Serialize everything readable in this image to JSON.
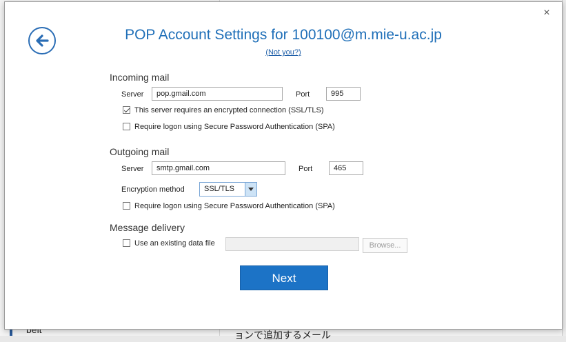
{
  "background": {
    "left_text": "beit",
    "right_text": "ョンで追加するメール"
  },
  "dialog": {
    "title": "POP Account Settings for 100100@m.mie-u.ac.jp",
    "not_you": "(Not you?)",
    "close_label": "×",
    "incoming": {
      "heading": "Incoming mail",
      "server_label": "Server",
      "server_value": "pop.gmail.com",
      "port_label": "Port",
      "port_value": "995",
      "ssl_label": "This server requires an encrypted connection (SSL/TLS)",
      "ssl_checked": true,
      "spa_label": "Require logon using Secure Password Authentication (SPA)",
      "spa_checked": false
    },
    "outgoing": {
      "heading": "Outgoing mail",
      "server_label": "Server",
      "server_value": "smtp.gmail.com",
      "port_label": "Port",
      "port_value": "465",
      "encryption_label": "Encryption method",
      "encryption_value": "SSL/TLS",
      "spa_label": "Require logon using Secure Password Authentication (SPA)",
      "spa_checked": false
    },
    "delivery": {
      "heading": "Message delivery",
      "existing_label": "Use an existing data file",
      "existing_checked": false,
      "file_value": "",
      "browse_label": "Browse..."
    },
    "next_label": "Next"
  },
  "colors": {
    "accent": "#1f6fb8",
    "button": "#1c73c6"
  },
  "icons": {
    "back": "back-arrow-icon",
    "close": "close-icon"
  }
}
